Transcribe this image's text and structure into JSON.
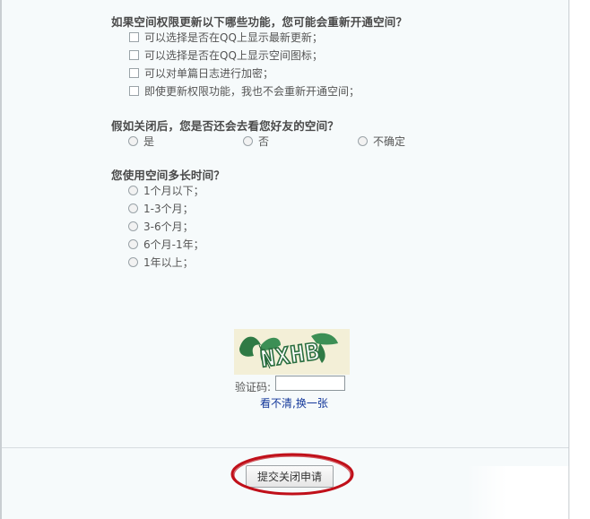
{
  "survey": {
    "q1": {
      "title": "如果空间权限更新以下哪些功能，您可能会重新开通空间？",
      "options": [
        "可以选择是否在QQ上显示最新更新；",
        "可以选择是否在QQ上显示空间图标；",
        "可以对单篇日志进行加密；",
        "即使更新权限功能，我也不会重新开通空间；"
      ]
    },
    "q2": {
      "title": "假如关闭后，您是否还会去看您好友的空间？",
      "options": [
        "是",
        "否",
        "不确定"
      ]
    },
    "q3": {
      "title": "您使用空间多长时间？",
      "options": [
        "1个月以下；",
        "1-3个月；",
        "3-6个月；",
        "6个月-1年；",
        "1年以上；"
      ]
    }
  },
  "captcha": {
    "image_text": "NXHB",
    "label": "验证码:",
    "input_value": "",
    "refresh_link": "看不清,换一张"
  },
  "submit": {
    "label": "提交关闭申请"
  },
  "colors": {
    "link": "#13379a",
    "annotation": "#c0101a",
    "captcha_green": "#2f7a45"
  }
}
